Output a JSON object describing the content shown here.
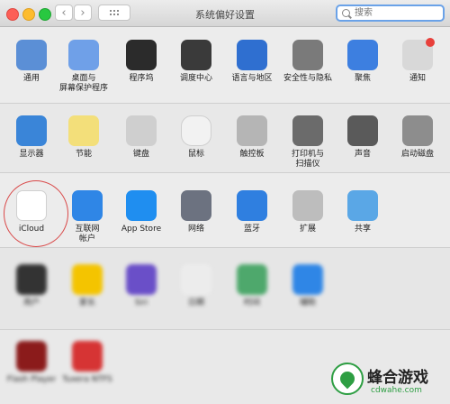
{
  "window": {
    "title": "系统偏好设置",
    "search_placeholder": "搜索",
    "back": "‹",
    "forward": "›"
  },
  "row1": [
    {
      "name": "general",
      "label": "通用",
      "color": "#5b8fd6"
    },
    {
      "name": "desktop-screensaver",
      "label": "桌面与\n屏幕保护程序",
      "color": "#6fa0e8"
    },
    {
      "name": "dock",
      "label": "程序坞",
      "color": "#2b2b2b"
    },
    {
      "name": "mission-control",
      "label": "调度中心",
      "color": "#3a3a3a"
    },
    {
      "name": "language-region",
      "label": "语言与地区",
      "color": "#2f6fd0"
    },
    {
      "name": "security-privacy",
      "label": "安全性与隐私",
      "color": "#7a7a7a"
    },
    {
      "name": "spotlight",
      "label": "聚焦",
      "color": "#3d7fe0"
    },
    {
      "name": "notifications",
      "label": "通知",
      "color": "#d8d8d8"
    }
  ],
  "row2": [
    {
      "name": "displays",
      "label": "显示器",
      "color": "#3a85d8"
    },
    {
      "name": "energy-saver",
      "label": "节能",
      "color": "#f3df7a"
    },
    {
      "name": "keyboard",
      "label": "键盘",
      "color": "#cfcfcf"
    },
    {
      "name": "mouse",
      "label": "鼠标",
      "color": "#f2f2f2"
    },
    {
      "name": "trackpad",
      "label": "触控板",
      "color": "#b5b5b5"
    },
    {
      "name": "printers-scanners",
      "label": "打印机与\n扫描仪",
      "color": "#6b6b6b"
    },
    {
      "name": "sound",
      "label": "声音",
      "color": "#5a5a5a"
    },
    {
      "name": "startup-disk",
      "label": "启动磁盘",
      "color": "#8d8d8d"
    }
  ],
  "row3": [
    {
      "name": "icloud",
      "label": "iCloud",
      "color": "#ffffff"
    },
    {
      "name": "internet-accounts",
      "label": "互联网\n帐户",
      "color": "#2f86e6"
    },
    {
      "name": "app-store",
      "label": "App Store",
      "color": "#1f8ef0"
    },
    {
      "name": "network",
      "label": "网络",
      "color": "#6c7280"
    },
    {
      "name": "bluetooth",
      "label": "蓝牙",
      "color": "#2f7fe0"
    },
    {
      "name": "extensions",
      "label": "扩展",
      "color": "#bdbdbd"
    },
    {
      "name": "sharing",
      "label": "共享",
      "color": "#5aa7e6"
    }
  ],
  "row4": [
    {
      "name": "users",
      "label": "用户",
      "color": "#333333"
    },
    {
      "name": "parental",
      "label": "家长",
      "color": "#f4c400"
    },
    {
      "name": "siri",
      "label": "Siri",
      "color": "#6a4fc8"
    },
    {
      "name": "datetime",
      "label": "日期",
      "color": "#ececec"
    },
    {
      "name": "timemachine",
      "label": "时间",
      "color": "#4ea86c"
    },
    {
      "name": "accessibility",
      "label": "辅助",
      "color": "#2f86e6"
    }
  ],
  "row5": [
    {
      "name": "flash-player",
      "label": "Flash Player",
      "color": "#8b1b1b"
    },
    {
      "name": "tuxera",
      "label": "Tuxera NTFS",
      "color": "#d63434"
    }
  ],
  "watermark": {
    "title": "蜂合游戏",
    "url": "cdwahe.com"
  }
}
